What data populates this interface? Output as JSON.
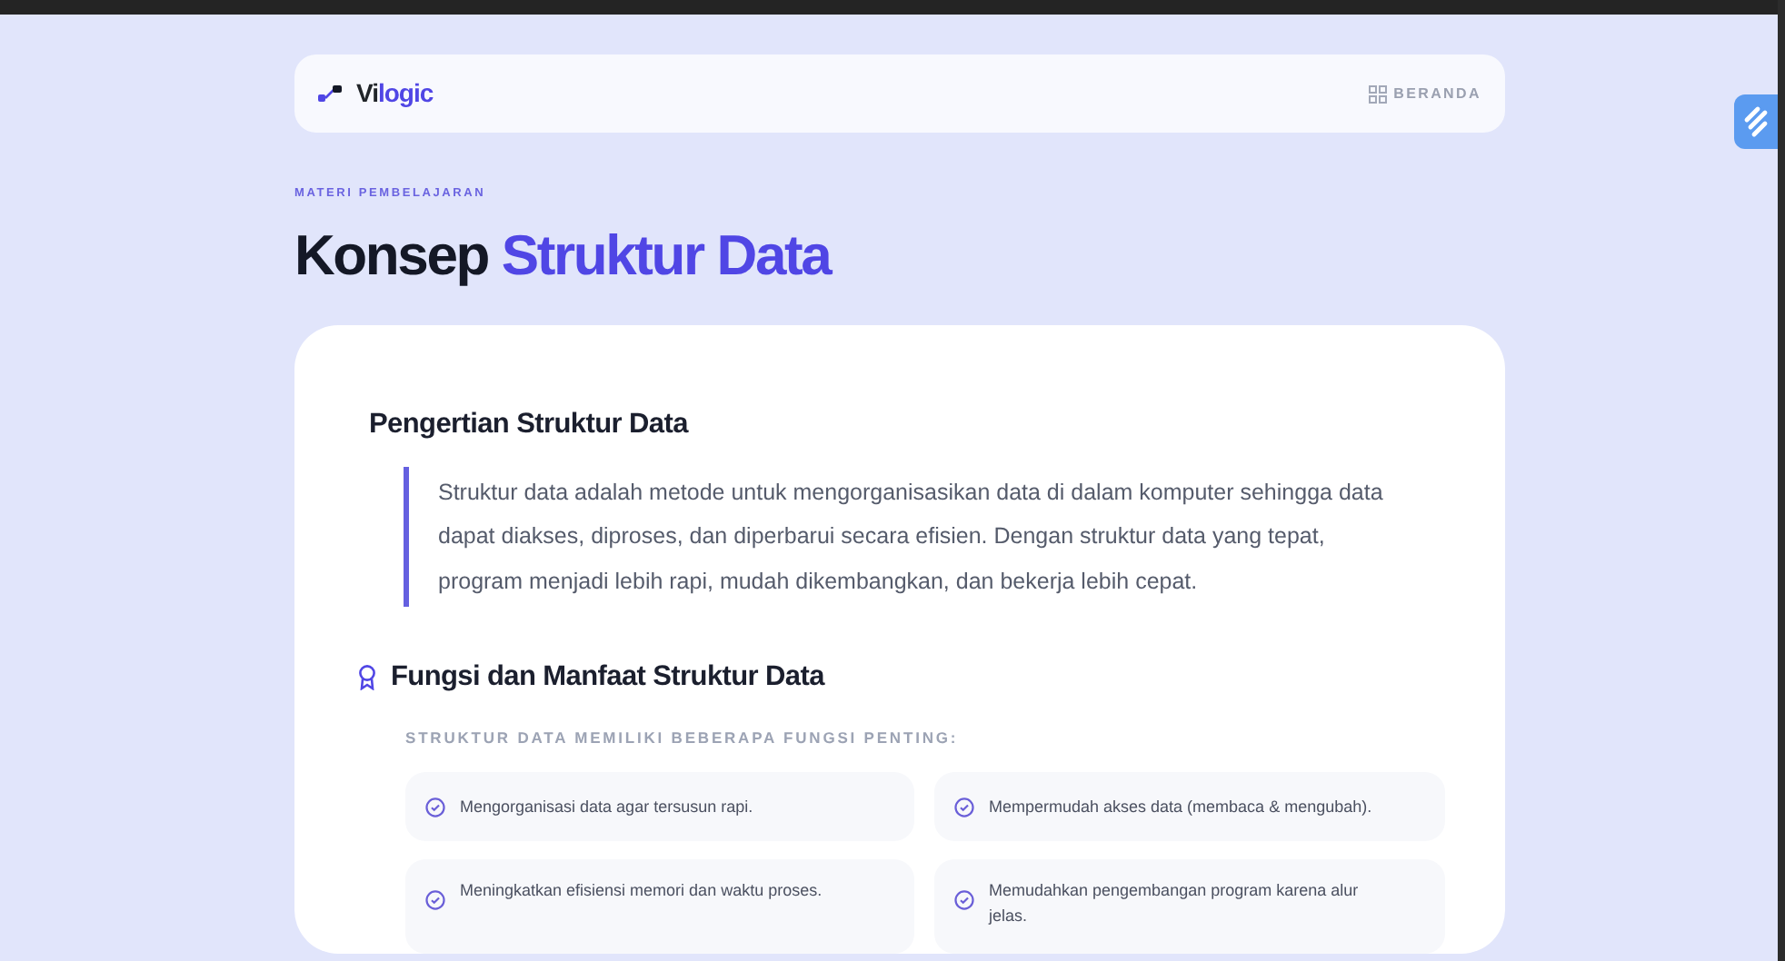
{
  "navbar": {
    "brand": {
      "dark_part": "Vi",
      "accent_part": "logic"
    },
    "link": "BERANDA"
  },
  "eyebrow": "MATERI PEMBELAJARAN",
  "title": {
    "plain_part": "Konsep",
    "accent_part": "Struktur Data"
  },
  "sections": [
    {
      "kind": "quote",
      "heading": "Pengertian Struktur Data",
      "text": "Struktur data adalah metode untuk mengorganisasikan data di dalam komputer sehingga data dapat diakses, diproses, dan diperbarui secara efisien. Dengan struktur data yang tepat, program menjadi lebih rapi, mudah dikembangkan, dan bekerja lebih cepat."
    },
    {
      "kind": "list",
      "heading": "Fungsi dan Manfaat Struktur Data",
      "subtitle": "STRUKTUR DATA MEMILIKI BEBERAPA FUNGSI PENTING:",
      "items": [
        "Mengorganisasi data agar tersusun rapi.",
        "Mempermudah akses data (membaca & mengubah).",
        "Meningkatkan efisiensi memori dan waktu proses.",
        "Memudahkan pengembangan program karena alur jelas."
      ]
    }
  ]
}
